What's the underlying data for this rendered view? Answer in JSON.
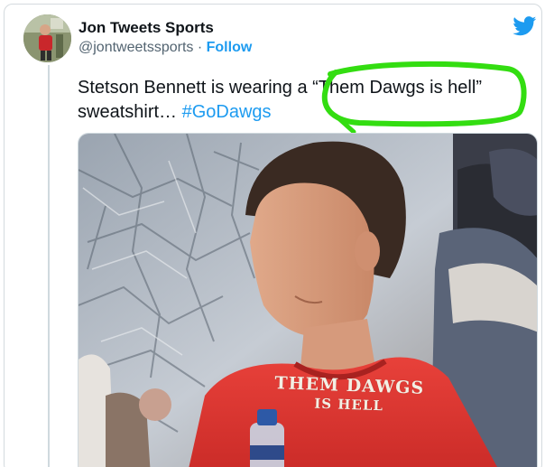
{
  "tweet": {
    "author_name": "Jon Tweets Sports",
    "author_handle": "@jontweetssports",
    "separator": " · ",
    "follow_label": "Follow",
    "text_part1": "Stetson Bennett is wearing a “Them Dawgs is hell” sweatshirt… ",
    "hashtag": "#GoDawgs"
  },
  "media": {
    "shirt_text_line1": "THEM DAWGS",
    "shirt_text_line2": "IS HELL"
  },
  "colors": {
    "accent": "#1d9bf0",
    "highlight": "#33dd11",
    "text": "#0f1419",
    "secondary": "#536471",
    "shirt": "#dd2f2c"
  },
  "icons": {
    "platform": "twitter-bird-icon"
  }
}
